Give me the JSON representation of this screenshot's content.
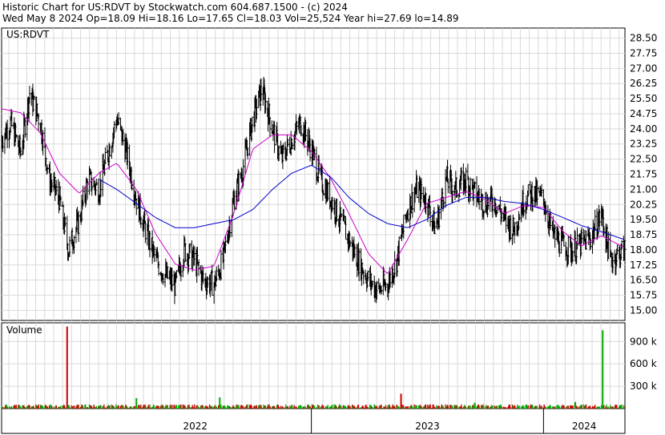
{
  "header": {
    "line1": "Historic Chart for US:RDVT by Stockwatch.com 604.687.1500 - (c) 2024",
    "line2": "Wed May  8 2024  Op=18.09  Hi=18.16  Lo=17.65  Cl=18.03  Vol=25,524  Year hi=27.69  lo=14.89"
  },
  "chart_data": [
    {
      "type": "line",
      "title": "US:RDVT",
      "ylim": [
        14.5,
        29.0
      ],
      "y_ticks": [
        "28.50",
        "27.75",
        "27.00",
        "26.25",
        "25.50",
        "24.75",
        "24.00",
        "23.25",
        "22.50",
        "21.75",
        "21.00",
        "20.25",
        "19.50",
        "18.75",
        "18.00",
        "17.25",
        "16.50",
        "15.75",
        "15.00"
      ],
      "x_tick_labels": [
        "2022",
        "2023",
        "2024"
      ],
      "x_tick_dates": [
        "2022-01-01",
        "2023-01-01",
        "2024-01-01"
      ],
      "x_range": [
        "2021-09-01",
        "2024-05-08"
      ],
      "grid": true,
      "price_closes": [
        [
          "2021-09-01",
          23.5
        ],
        [
          "2021-09-15",
          24.3
        ],
        [
          "2021-10-01",
          22.8
        ],
        [
          "2021-10-15",
          25.8
        ],
        [
          "2021-11-01",
          24.3
        ],
        [
          "2021-11-15",
          21.5
        ],
        [
          "2021-12-01",
          20.5
        ],
        [
          "2021-12-15",
          18.0
        ],
        [
          "2022-01-01",
          19.5
        ],
        [
          "2022-01-15",
          21.5
        ],
        [
          "2022-02-01",
          21.0
        ],
        [
          "2022-02-15",
          22.8
        ],
        [
          "2022-03-01",
          24.5
        ],
        [
          "2022-03-15",
          23.0
        ],
        [
          "2022-04-01",
          20.5
        ],
        [
          "2022-04-15",
          19.0
        ],
        [
          "2022-05-01",
          17.5
        ],
        [
          "2022-05-15",
          16.8
        ],
        [
          "2022-06-01",
          16.2
        ],
        [
          "2022-06-15",
          18.0
        ],
        [
          "2022-07-01",
          17.5
        ],
        [
          "2022-07-15",
          16.5
        ],
        [
          "2022-08-01",
          16.3
        ],
        [
          "2022-08-15",
          17.5
        ],
        [
          "2022-09-01",
          20.5
        ],
        [
          "2022-09-15",
          22.0
        ],
        [
          "2022-10-01",
          24.5
        ],
        [
          "2022-10-15",
          26.0
        ],
        [
          "2022-11-01",
          24.0
        ],
        [
          "2022-11-15",
          22.5
        ],
        [
          "2022-12-01",
          23.5
        ],
        [
          "2022-12-15",
          24.3
        ],
        [
          "2023-01-01",
          23.0
        ],
        [
          "2023-01-15",
          21.5
        ],
        [
          "2023-02-01",
          20.5
        ],
        [
          "2023-02-15",
          19.5
        ],
        [
          "2023-03-01",
          18.5
        ],
        [
          "2023-03-15",
          17.5
        ],
        [
          "2023-04-01",
          16.5
        ],
        [
          "2023-04-15",
          16.0
        ],
        [
          "2023-05-01",
          16.3
        ],
        [
          "2023-05-15",
          17.5
        ],
        [
          "2023-06-01",
          20.0
        ],
        [
          "2023-06-15",
          21.0
        ],
        [
          "2023-07-01",
          20.5
        ],
        [
          "2023-07-15",
          19.0
        ],
        [
          "2023-08-01",
          21.5
        ],
        [
          "2023-08-15",
          21.0
        ],
        [
          "2023-09-01",
          21.5
        ],
        [
          "2023-09-15",
          20.8
        ],
        [
          "2023-10-01",
          20.3
        ],
        [
          "2023-10-15",
          20.5
        ],
        [
          "2023-11-01",
          19.5
        ],
        [
          "2023-11-15",
          19.0
        ],
        [
          "2023-12-01",
          20.5
        ],
        [
          "2023-12-15",
          20.8
        ],
        [
          "2024-01-01",
          20.5
        ],
        [
          "2024-01-15",
          18.8
        ],
        [
          "2024-02-01",
          18.2
        ],
        [
          "2024-02-15",
          18.0
        ],
        [
          "2024-03-01",
          18.3
        ],
        [
          "2024-03-15",
          18.6
        ],
        [
          "2024-04-01",
          19.8
        ],
        [
          "2024-04-15",
          17.5
        ],
        [
          "2024-05-08",
          18.03
        ]
      ],
      "price_color": "#000000",
      "series": [
        {
          "color": "#cc00cc",
          "points": [
            [
              "2021-09-01",
              25.0
            ],
            [
              "2021-10-01",
              24.8
            ],
            [
              "2021-11-01",
              23.8
            ],
            [
              "2021-12-01",
              21.8
            ],
            [
              "2022-01-01",
              20.8
            ],
            [
              "2022-02-01",
              21.8
            ],
            [
              "2022-03-01",
              22.3
            ],
            [
              "2022-04-01",
              21.0
            ],
            [
              "2022-05-01",
              18.8
            ],
            [
              "2022-06-01",
              17.3
            ],
            [
              "2022-07-01",
              17.0
            ],
            [
              "2022-08-01",
              17.2
            ],
            [
              "2022-09-01",
              19.8
            ],
            [
              "2022-10-01",
              23.0
            ],
            [
              "2022-11-01",
              23.7
            ],
            [
              "2022-12-01",
              23.7
            ],
            [
              "2023-01-01",
              22.9
            ],
            [
              "2023-02-01",
              21.5
            ],
            [
              "2023-03-01",
              19.8
            ],
            [
              "2023-04-01",
              17.8
            ],
            [
              "2023-05-01",
              16.8
            ],
            [
              "2023-06-01",
              18.5
            ],
            [
              "2023-07-01",
              20.3
            ],
            [
              "2023-08-01",
              20.6
            ],
            [
              "2023-09-01",
              20.9
            ],
            [
              "2023-10-01",
              20.5
            ],
            [
              "2023-11-01",
              19.8
            ],
            [
              "2023-12-01",
              20.2
            ],
            [
              "2024-01-01",
              20.1
            ],
            [
              "2024-02-01",
              18.9
            ],
            [
              "2024-03-01",
              18.2
            ],
            [
              "2024-04-01",
              18.7
            ],
            [
              "2024-05-08",
              18.1
            ]
          ]
        },
        {
          "color": "#0000cc",
          "points": [
            [
              "2022-02-01",
              21.5
            ],
            [
              "2022-03-01",
              21.0
            ],
            [
              "2022-04-01",
              20.3
            ],
            [
              "2022-05-01",
              19.6
            ],
            [
              "2022-06-01",
              19.1
            ],
            [
              "2022-07-01",
              19.1
            ],
            [
              "2022-08-01",
              19.3
            ],
            [
              "2022-09-01",
              19.5
            ],
            [
              "2022-10-01",
              20.0
            ],
            [
              "2022-11-01",
              21.0
            ],
            [
              "2022-12-01",
              21.8
            ],
            [
              "2023-01-01",
              22.2
            ],
            [
              "2023-02-01",
              21.6
            ],
            [
              "2023-03-01",
              20.6
            ],
            [
              "2023-04-01",
              19.8
            ],
            [
              "2023-05-01",
              19.3
            ],
            [
              "2023-06-01",
              19.1
            ],
            [
              "2023-07-01",
              19.5
            ],
            [
              "2023-08-01",
              20.2
            ],
            [
              "2023-09-01",
              20.6
            ],
            [
              "2023-10-01",
              20.6
            ],
            [
              "2023-11-01",
              20.4
            ],
            [
              "2023-12-01",
              20.3
            ],
            [
              "2024-01-01",
              20.0
            ],
            [
              "2024-02-01",
              19.6
            ],
            [
              "2024-03-01",
              19.2
            ],
            [
              "2024-04-01",
              18.9
            ],
            [
              "2024-05-08",
              18.5
            ]
          ]
        }
      ]
    },
    {
      "type": "bar",
      "title": "Volume",
      "y_ticks": [
        "900 k",
        "600 k",
        "300 k"
      ],
      "ylim_k": [
        0,
        1150
      ],
      "up_color": "#00aa00",
      "down_color": "#cc0000",
      "bars": [
        [
          "2021-12-13",
          1100,
          "down"
        ],
        [
          "2022-08-10",
          150,
          "up"
        ],
        [
          "2023-05-22",
          200,
          "down"
        ],
        [
          "2024-04-03",
          1050,
          "up"
        ],
        [
          "2022-04-01",
          140,
          "up"
        ],
        [
          "2023-09-15",
          80,
          "up"
        ],
        [
          "2024-02-20",
          90,
          "up"
        ]
      ],
      "baseline_k": 40
    }
  ]
}
